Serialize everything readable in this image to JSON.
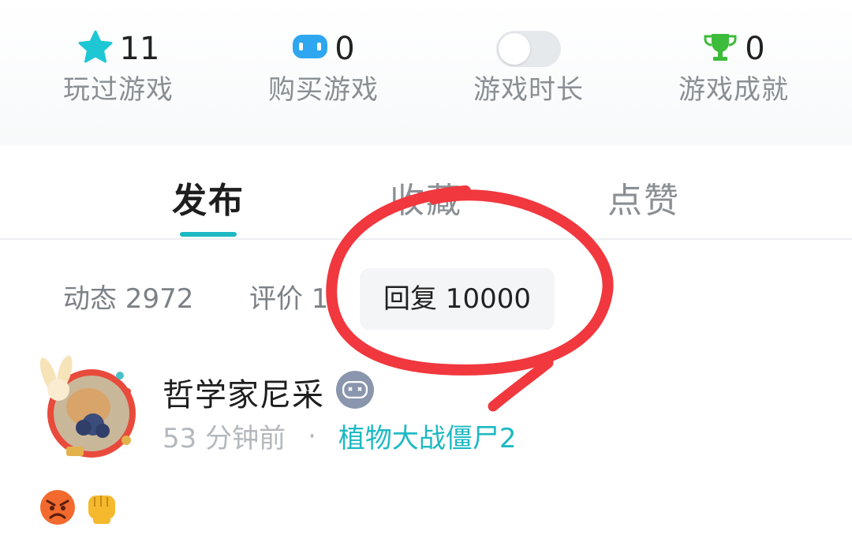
{
  "stats": [
    {
      "icon": "star-icon",
      "count": "11",
      "label": "玩过游戏"
    },
    {
      "icon": "gamepad-icon",
      "count": "0",
      "label": "购买游戏"
    },
    {
      "icon": "toggle-switch",
      "count": "",
      "label": "游戏时长"
    },
    {
      "icon": "trophy-icon",
      "count": "0",
      "label": "游戏成就"
    }
  ],
  "tabs": {
    "publish": "发布",
    "favorites": "收藏",
    "likes": "点赞"
  },
  "subtabs": {
    "dynamics": "动态 2972",
    "reviews": "评价 1",
    "replies": "回复 10000"
  },
  "post": {
    "username": "哲学家尼采",
    "time": "53 分钟前",
    "dot": "·",
    "game": "植物大战僵尸2",
    "emojis": [
      "angry-face-emoji",
      "fist-emoji"
    ]
  },
  "colors": {
    "accent": "#1db9c3",
    "star": "#1fc7d4",
    "gamepad": "#2ea7f0",
    "trophy": "#3dbb3a",
    "annotation": "#f0383e"
  }
}
